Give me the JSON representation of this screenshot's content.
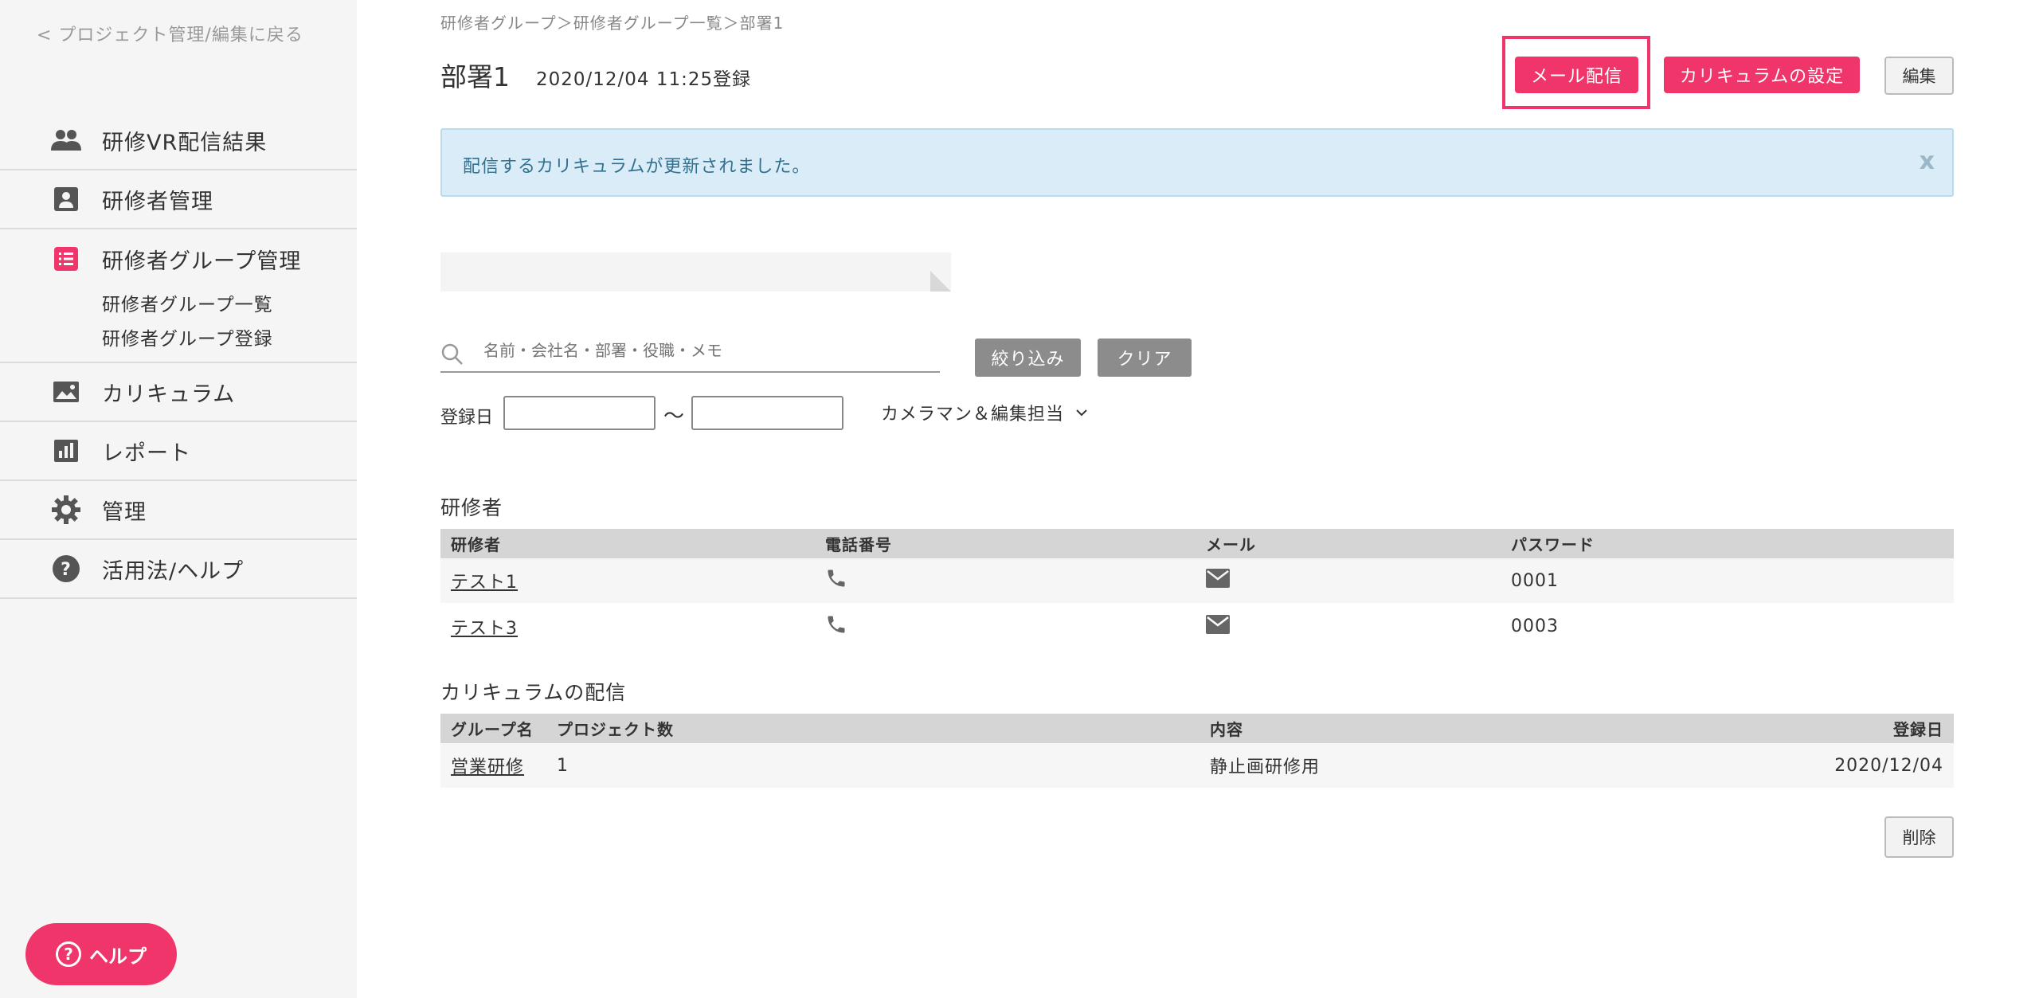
{
  "sidebar": {
    "back_link": "< プロジェクト管理/編集に戻る",
    "items": [
      {
        "label": "研修VR配信結果",
        "icon": "people-icon"
      },
      {
        "label": "研修者管理",
        "icon": "person-card-icon"
      },
      {
        "label": "研修者グループ管理",
        "icon": "list-icon"
      },
      {
        "label": "カリキュラム",
        "icon": "image-icon"
      },
      {
        "label": "レポート",
        "icon": "bar-chart-icon"
      },
      {
        "label": "管理",
        "icon": "gear-icon"
      },
      {
        "label": "活用法/ヘルプ",
        "icon": "question-icon"
      }
    ],
    "subitems": [
      "研修者グループ一覧",
      "研修者グループ登録"
    ],
    "help_button": "ヘルプ",
    "accent_color": "#f0356a"
  },
  "header": {
    "breadcrumb": "研修者グループ＞研修者グループ一覧＞部署1",
    "title": "部署1",
    "registered": "2020/12/04 11:25登録",
    "mail_button": "メール配信",
    "curriculum_button": "カリキュラムの設定",
    "edit_button": "編集"
  },
  "alert": {
    "message": "配信するカリキュラムが更新されました。",
    "close": "x"
  },
  "search": {
    "placeholder": "名前・会社名・部署・役職・メモ",
    "filter_button": "絞り込み",
    "clear_button": "クリア",
    "date_label": "登録日",
    "tilde": "〜",
    "camera_select": "カメラマン＆編集担当"
  },
  "trainees": {
    "title": "研修者",
    "columns": [
      "研修者",
      "電話番号",
      "メール",
      "パスワード"
    ],
    "rows": [
      {
        "name": "テスト1",
        "password": "0001"
      },
      {
        "name": "テスト3",
        "password": "0003"
      }
    ]
  },
  "curriculum": {
    "title": "カリキュラムの配信",
    "columns": [
      "グループ名",
      "プロジェクト数",
      "内容",
      "登録日"
    ],
    "rows": [
      {
        "group": "営業研修",
        "count": "1",
        "content": "静止画研修用",
        "date": "2020/12/04"
      }
    ],
    "delete_button": "削除"
  }
}
